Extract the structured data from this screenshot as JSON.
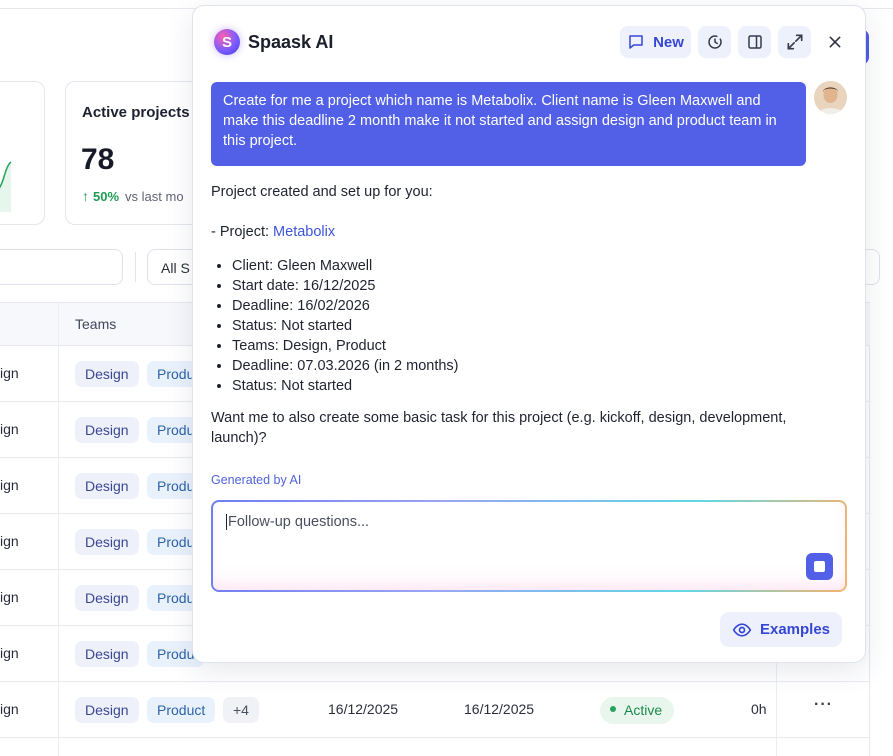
{
  "stats": {
    "active_projects": {
      "title": "Active projects",
      "value": "78",
      "trend_arrow": "↑",
      "trend_percent": "50%",
      "trend_label": "vs last mo"
    }
  },
  "filters": {
    "status_select": "All S"
  },
  "table": {
    "headers": {
      "teams": "Teams"
    },
    "rows": [
      {
        "team": "ign",
        "tag1": "Design",
        "tag2": "Produ"
      },
      {
        "team": "ign",
        "tag1": "Design",
        "tag2": "Produ"
      },
      {
        "team": "ign",
        "tag1": "Design",
        "tag2": "Produ"
      },
      {
        "team": "ign",
        "tag1": "Design",
        "tag2": "Produ"
      },
      {
        "team": "ign",
        "tag1": "Design",
        "tag2": "Produ"
      },
      {
        "team": "ign",
        "tag1": "Design",
        "tag2": "Produ"
      },
      {
        "team": "ign",
        "tag1": "Design",
        "tag2": "Product",
        "more": "+4",
        "start": "16/12/2025",
        "deadline": "16/12/2025",
        "status": "Active",
        "hours": "0h",
        "menu": "···"
      }
    ]
  },
  "panel": {
    "brand_icon": "S",
    "brand_name": "Spaask AI",
    "new_label": "New",
    "user_message": "Create for me a project which name is Metabolix. Client name is Gleen Maxwell and make this deadline 2 month make it not started and assign design and product team in this project.",
    "reply": {
      "intro": "Project created and set up for you:",
      "project_prefix": "- Project: ",
      "project_name": "Metabolix",
      "items": [
        "Client: Gleen Maxwell",
        "Start date: 16/12/2025",
        "Deadline: 16/02/2026",
        "Status: Not started",
        "Teams: Design, Product",
        "Deadline: 07.03.2026 (in 2 months)",
        "Status: Not started"
      ],
      "question": "Want me to also create some basic task for this project (e.g. kickoff, design, development, launch)?"
    },
    "generated_label": "Generated by AI",
    "followup_placeholder": "Follow-up questions...",
    "examples_label": "Examples"
  },
  "colors": {
    "accent": "#5160e6",
    "accent_text": "#3447d6",
    "success": "#1f9b55"
  }
}
